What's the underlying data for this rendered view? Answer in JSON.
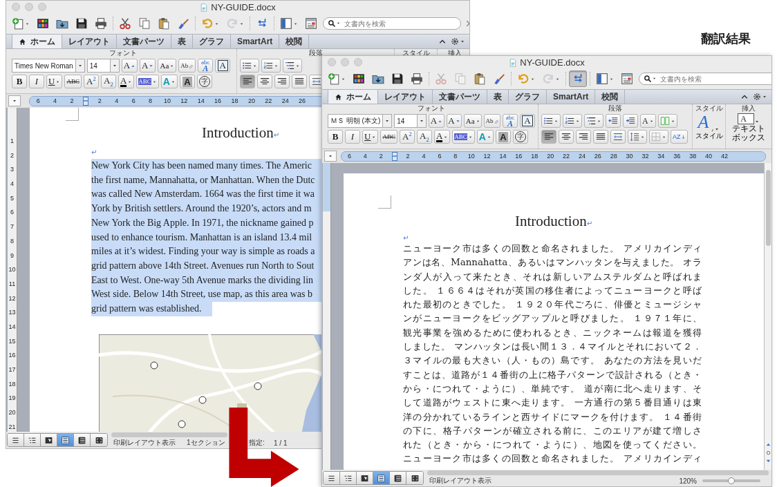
{
  "caption": "翻訳結果",
  "windows": [
    {
      "title": "NY-GUIDE.docx",
      "toolbar": [
        {
          "kind": "new",
          "menu": true,
          "disabled": false,
          "pressed": false
        },
        {
          "kind": "gallery",
          "menu": false,
          "disabled": false,
          "pressed": false
        },
        {
          "kind": "open",
          "menu": false,
          "disabled": false,
          "pressed": false
        },
        {
          "kind": "save",
          "menu": false,
          "disabled": false,
          "pressed": false
        },
        {
          "kind": "print",
          "menu": false,
          "disabled": false,
          "pressed": false
        },
        {
          "kind": "cut",
          "menu": false,
          "disabled": false,
          "pressed": false
        },
        {
          "kind": "copy",
          "menu": false,
          "disabled": false,
          "pressed": false
        },
        {
          "kind": "paste",
          "menu": false,
          "disabled": false,
          "pressed": false
        },
        {
          "kind": "brush",
          "menu": false,
          "disabled": false,
          "pressed": false
        },
        {
          "kind": "undo",
          "menu": true,
          "disabled": false,
          "pressed": false
        },
        {
          "kind": "redo",
          "menu": true,
          "disabled": true,
          "pressed": false
        },
        {
          "kind": "swap",
          "menu": false,
          "disabled": false,
          "pressed": false
        },
        {
          "kind": "sidebar",
          "menu": true,
          "disabled": false,
          "pressed": false
        },
        {
          "kind": "media",
          "menu": false,
          "disabled": false,
          "pressed": false
        }
      ],
      "search": {
        "placeholder": "文書内を検索"
      },
      "tabs": [
        {
          "label": "ホーム",
          "selected": true
        },
        {
          "label": "レイアウト",
          "selected": false
        },
        {
          "label": "文書パーツ",
          "selected": false
        },
        {
          "label": "表",
          "selected": false
        },
        {
          "label": "グラフ",
          "selected": false
        },
        {
          "label": "SmartArt",
          "selected": false
        },
        {
          "label": "校閲",
          "selected": false
        }
      ],
      "ribbon": [
        {
          "label": "フォント",
          "top": [
            {
              "kind": "font-field",
              "label": "Times New Roman",
              "menu": true
            },
            {
              "kind": "size-field",
              "label": "14",
              "menu": true
            },
            {
              "kind": "grow",
              "label": "A",
              "menu": false
            },
            {
              "kind": "shrink",
              "label": "A",
              "menu": false
            },
            {
              "kind": "case",
              "label": "Aa",
              "menu": true
            },
            {
              "kind": "clear",
              "label": "Ab",
              "menu": false
            },
            {
              "kind": "effects",
              "label": "abc",
              "label2": "A",
              "menu": false
            },
            {
              "kind": "box",
              "label": "A",
              "menu": false
            }
          ],
          "bottom": [
            {
              "kind": "bold",
              "label": "B",
              "menu": false
            },
            {
              "kind": "italic",
              "label": "I",
              "menu": false
            },
            {
              "kind": "underline",
              "label": "U",
              "menu": true
            },
            {
              "kind": "strike",
              "label": "ABC",
              "menu": false
            },
            {
              "kind": "superscript",
              "label": "A$^{2}$",
              "menu": false
            },
            {
              "kind": "subscript",
              "label": "A$_{2}$",
              "menu": false
            },
            {
              "kind": "color",
              "label": "A",
              "menu": true
            },
            {
              "kind": "highlight",
              "label": "ABC",
              "menu": true
            },
            {
              "kind": "glow",
              "label": "A",
              "menu": true
            },
            {
              "kind": "shade",
              "label": "A",
              "menu": false
            },
            {
              "kind": "enclose",
              "label": "字",
              "menu": false
            }
          ]
        },
        {
          "label": "段落",
          "top": [
            {
              "kind": "bullets",
              "menu": true,
              "selected": false
            },
            {
              "kind": "numbering",
              "menu": true,
              "selected": false
            },
            {
              "kind": "multilevel",
              "menu": true,
              "selected": false
            }
          ],
          "bottom": [
            {
              "kind": "align-left",
              "menu": false,
              "selected": true
            },
            {
              "kind": "align-center",
              "menu": false,
              "selected": false
            },
            {
              "kind": "align-right",
              "menu": false,
              "selected": false
            },
            {
              "kind": "justify",
              "menu": false,
              "selected": false
            },
            {
              "kind": "distribute",
              "menu": false,
              "selected": false
            }
          ]
        },
        {
          "label": "スタイル"
        },
        {
          "label": "挿入"
        }
      ],
      "ruler": {
        "before": [
          "6",
          "4",
          "2"
        ],
        "after": [
          "2",
          "4",
          "6",
          "8",
          "10",
          "12",
          "14",
          "16",
          "18",
          "20",
          "22",
          "24",
          "26"
        ]
      },
      "vertical_ruler": [
        "1",
        "2",
        "3",
        "4",
        "5",
        "6",
        "7",
        "8",
        "9",
        "10",
        "11",
        "12",
        "13",
        "14",
        "15",
        "16",
        "17",
        "18",
        "19",
        "20",
        "21"
      ],
      "document": {
        "heading": "Introduction",
        "heading_mark": "↵",
        "empty_mark": "↵",
        "selected": true,
        "lines": [
          "New York City has been named many times. The Americ",
          "the first name, Mannahatta, or Manhattan. When the Dutc",
          "was called New Amsterdam. 1664 was the first time it wa",
          "York by British settlers. Around the 1920’s, actors and m",
          "New York the Big Apple. In 1971, the nickname gained p",
          "used to enhance tourism. Manhattan is an island 13.4 mil",
          "miles at it’s widest. Finding your way is simple as roads a",
          "grid pattern above 14th Street. Avenues run North to Sout",
          "East to West. One-way 5th Avenue marks the dividing lin",
          "West side. Below 14th Street, use map, as this area was b",
          "grid pattern was established."
        ]
      },
      "view_buttons": [
        {
          "kind": "draft",
          "selected": false
        },
        {
          "kind": "outline",
          "selected": false
        },
        {
          "kind": "notebook",
          "selected": false
        },
        {
          "kind": "page",
          "selected": true
        },
        {
          "kind": "publishing",
          "selected": false
        },
        {
          "kind": "full",
          "selected": false
        }
      ],
      "status": [
        "印刷レイアウト表示",
        "1セクション",
        "指定:",
        "1 / 1"
      ]
    },
    {
      "title": "NY-GUIDE.docx",
      "toolbar": [
        {
          "kind": "new",
          "menu": true,
          "disabled": false,
          "pressed": false
        },
        {
          "kind": "gallery",
          "menu": false,
          "disabled": false,
          "pressed": false
        },
        {
          "kind": "open",
          "menu": false,
          "disabled": false,
          "pressed": false
        },
        {
          "kind": "save",
          "menu": false,
          "disabled": false,
          "pressed": false
        },
        {
          "kind": "print",
          "menu": false,
          "disabled": false,
          "pressed": false
        },
        {
          "kind": "cut",
          "menu": false,
          "disabled": true,
          "pressed": false
        },
        {
          "kind": "copy",
          "menu": false,
          "disabled": true,
          "pressed": false
        },
        {
          "kind": "paste",
          "menu": false,
          "disabled": false,
          "pressed": false
        },
        {
          "kind": "brush",
          "menu": false,
          "disabled": false,
          "pressed": false
        },
        {
          "kind": "undo",
          "menu": true,
          "disabled": false,
          "pressed": false
        },
        {
          "kind": "redo",
          "menu": true,
          "disabled": true,
          "pressed": false
        },
        {
          "kind": "swap",
          "menu": false,
          "disabled": false,
          "pressed": true
        },
        {
          "kind": "sidebar",
          "menu": true,
          "disabled": false,
          "pressed": false
        },
        {
          "kind": "media",
          "menu": false,
          "disabled": false,
          "pressed": false
        }
      ],
      "search": {
        "placeholder": "文書内を検索"
      },
      "tabs": [
        {
          "label": "ホーム",
          "selected": true
        },
        {
          "label": "レイアウト",
          "selected": false
        },
        {
          "label": "文書パーツ",
          "selected": false
        },
        {
          "label": "表",
          "selected": false
        },
        {
          "label": "グラフ",
          "selected": false
        },
        {
          "label": "SmartArt",
          "selected": false
        },
        {
          "label": "校閲",
          "selected": false
        }
      ],
      "ribbon": [
        {
          "label": "フォント",
          "top": [
            {
              "kind": "font-field",
              "label": "ＭＳ 明朝 (本文)",
              "menu": true
            },
            {
              "kind": "size-field",
              "label": "14",
              "menu": true
            },
            {
              "kind": "grow",
              "label": "A",
              "menu": false
            },
            {
              "kind": "shrink",
              "label": "A",
              "menu": false
            },
            {
              "kind": "case",
              "label": "Aa",
              "menu": true
            },
            {
              "kind": "clear",
              "label": "Ab",
              "menu": false
            },
            {
              "kind": "effects",
              "label": "abc",
              "label2": "A",
              "menu": false
            },
            {
              "kind": "box",
              "label": "A",
              "menu": false
            }
          ],
          "bottom": [
            {
              "kind": "bold",
              "label": "B",
              "menu": false
            },
            {
              "kind": "italic",
              "label": "I",
              "menu": false
            },
            {
              "kind": "underline",
              "label": "U",
              "menu": true
            },
            {
              "kind": "strike",
              "label": "ABC",
              "menu": false
            },
            {
              "kind": "superscript",
              "label": "A$^{2}$",
              "menu": false
            },
            {
              "kind": "subscript",
              "label": "A$_{2}$",
              "menu": false
            },
            {
              "kind": "color",
              "label": "A",
              "menu": true
            },
            {
              "kind": "highlight",
              "label": "ABC",
              "menu": true
            },
            {
              "kind": "glow",
              "label": "A",
              "menu": true
            },
            {
              "kind": "shade",
              "label": "A",
              "menu": false
            },
            {
              "kind": "enclose",
              "label": "字",
              "menu": false
            }
          ]
        },
        {
          "label": "段落",
          "top": [
            {
              "kind": "bullets",
              "menu": true,
              "selected": false
            },
            {
              "kind": "numbering",
              "menu": true,
              "selected": false
            },
            {
              "kind": "multilevel",
              "menu": true,
              "selected": false
            },
            {
              "kind": "outdent",
              "menu": false,
              "selected": false
            },
            {
              "kind": "indent",
              "menu": false,
              "selected": false
            },
            {
              "kind": "direction",
              "label": "A",
              "menu": true,
              "selected": false
            },
            {
              "kind": "columns",
              "menu": true,
              "selected": false
            }
          ],
          "bottom": [
            {
              "kind": "align-left",
              "menu": false,
              "selected": true
            },
            {
              "kind": "align-center",
              "menu": false,
              "selected": false
            },
            {
              "kind": "align-right",
              "menu": false,
              "selected": false
            },
            {
              "kind": "justify",
              "menu": false,
              "selected": false
            },
            {
              "kind": "distribute",
              "menu": false,
              "selected": false
            },
            {
              "kind": "spacing",
              "menu": true,
              "selected": false
            },
            {
              "kind": "borders",
              "menu": true,
              "selected": false
            },
            {
              "kind": "sort",
              "label": "A",
              "label2": "Z",
              "menu": false,
              "selected": false
            }
          ]
        },
        {
          "label": "スタイル",
          "big": {
            "kind": "style",
            "label": "A",
            "caption": "スタイル"
          }
        },
        {
          "label": "挿入",
          "big": {
            "kind": "textbox",
            "label": "A",
            "caption": "テキストボックス"
          }
        }
      ],
      "ruler": {
        "before": [
          "6",
          "4",
          "2"
        ],
        "after": [
          "2",
          "4",
          "6",
          "8",
          "10",
          "12",
          "14",
          "16",
          "18",
          "20",
          "22",
          "24",
          "26",
          "28",
          "30",
          "32",
          "34",
          "36",
          "38",
          "40",
          "42"
        ]
      },
      "document": {
        "heading": "Introduction",
        "heading_mark": "↵",
        "empty_mark": "↵",
        "selected": false,
        "lines": [
          "ニューヨーク市は多くの回数と命名されました。 アメリカインディ",
          "アンは名、Mannahatta、あるいはマンハッタンを与えました。 オラ",
          "ンダ人が入って来たとき、それは新しいアムステルダムと呼ばれま",
          "した。 １６６４はそれが英国の移住者によってニューヨークと呼ば",
          "れた最初のときでした。 １９２０年代ごろに、俳優とミュージシャ",
          "ンがニューヨークをビッグアップルと呼びました。 １９７１年に、",
          "観光事業を強めるために使われるとき、ニックネームは報道を獲得",
          "しました。 マンハッタンは長い間１３．４マイルとそれにおいて２．",
          "３マイルの最も大きい（人・もの）島です。 あなたの方法を見いだ",
          "すことは、道路が１４番街の上に格子パターンで設計される（とき・",
          "から・につれて・ように）、単純です。 道が南に北へ走ります、そ",
          "して道路がウェストに東へ走ります。 一方通行の第５番目通りは東",
          "洋の分かれているラインと西サイドにマークを付けます。 １４番街",
          "の下に、格子パターンが確立される前に、このエリアが建て増しさ",
          "れた（とき・から・につれて・ように）、地図を使ってください。",
          "ニューヨーク市は多くの回数と命名されました。 アメリカインディ"
        ]
      },
      "view_buttons": [
        {
          "kind": "draft",
          "selected": false
        },
        {
          "kind": "outline",
          "selected": false
        },
        {
          "kind": "notebook",
          "selected": false
        },
        {
          "kind": "page",
          "selected": true
        },
        {
          "kind": "publishing",
          "selected": false
        },
        {
          "kind": "full",
          "selected": false
        }
      ],
      "status": [
        "印刷レイアウト表示"
      ],
      "zoom": {
        "reading": "120%",
        "level": 0.5
      }
    }
  ]
}
